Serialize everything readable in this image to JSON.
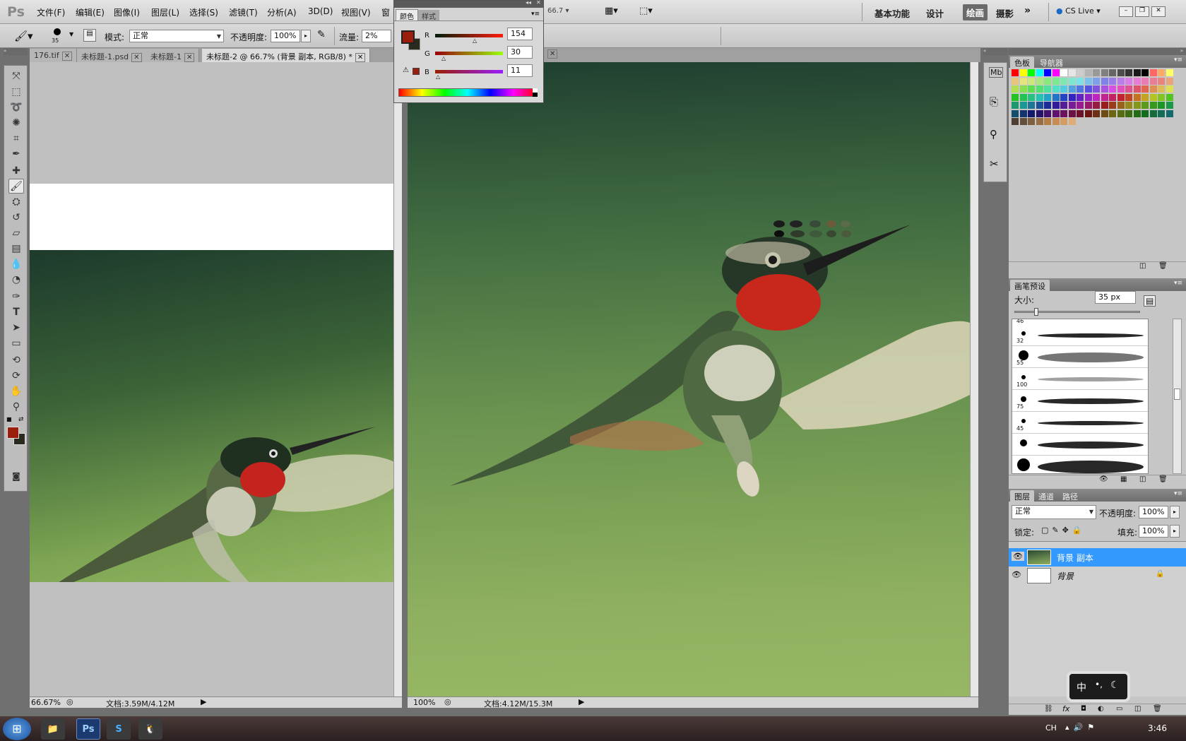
{
  "app": {
    "logo": "Ps"
  },
  "menu": [
    "文件(F)",
    "编辑(E)",
    "图像(I)",
    "图层(L)",
    "选择(S)",
    "滤镜(T)",
    "分析(A)",
    "3D(D)",
    "视图(V)",
    "窗"
  ],
  "zoom_field": "66.7",
  "workspaces": [
    "基本功能",
    "设计",
    "绘画",
    "摄影"
  ],
  "active_workspace": "绘画",
  "cs_live": "CS Live",
  "options": {
    "brush_size": "35",
    "mode_label": "模式:",
    "mode_value": "正常",
    "opacity_label": "不透明度:",
    "opacity_value": "100%",
    "flow_label": "流量:",
    "flow_value": "2%"
  },
  "doc_tabs": [
    {
      "label": "176.tif"
    },
    {
      "label": "未标题-1.psd"
    },
    {
      "label": "未标题-1"
    },
    {
      "label": "未标题-2 @ 66.7% (背景 副本, RGB/8) *"
    }
  ],
  "color_panel": {
    "tabs": [
      "颜色",
      "样式"
    ],
    "r_label": "R",
    "r": "154",
    "g_label": "G",
    "g": "30",
    "b_label": "B",
    "b": "11",
    "fg": "#9a1e0b",
    "bg": "#2a2a1e"
  },
  "doc_left": {
    "zoom": "66.67%",
    "doc": "文档:3.59M/4.12M"
  },
  "doc_right": {
    "zoom": "100%",
    "doc": "文档:4.12M/15.3M"
  },
  "swatches_panel": {
    "tabs": [
      "色板",
      "导航器"
    ]
  },
  "brush_panel": {
    "title": "画笔预设",
    "size_label": "大小:",
    "size_value": "35 px",
    "sizes": [
      "46",
      "32",
      "55",
      "100",
      "75",
      "45",
      "",
      ""
    ]
  },
  "layers_panel": {
    "tabs": [
      "图层",
      "通道",
      "路径"
    ],
    "blend": "正常",
    "opacity_label": "不透明度:",
    "opacity": "100%",
    "lock_label": "锁定:",
    "fill_label": "填充:",
    "fill": "100%",
    "layers": [
      {
        "name": "背景 副本",
        "selected": true
      },
      {
        "name": "背景",
        "selected": false
      }
    ]
  },
  "ime": {
    "label": "中"
  },
  "taskbar": {
    "lang": "CH",
    "time": "3:46"
  },
  "colors": {
    "fg": "#9a1e0b",
    "selection": "#3399ff",
    "canvas_top": "#23422f",
    "canvas_bottom": "#93b35e"
  }
}
